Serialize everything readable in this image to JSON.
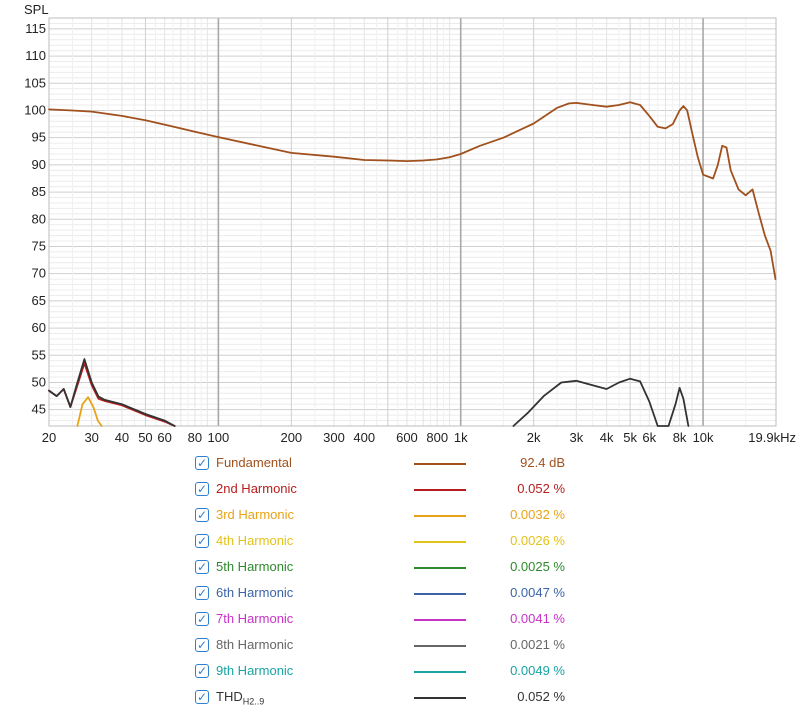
{
  "chart_data": {
    "type": "line",
    "title": "",
    "ylabel": "SPL",
    "xlabel": "",
    "xscale": "log",
    "xlim": [
      20,
      20000
    ],
    "ylim": [
      42,
      117
    ],
    "grid": true,
    "y_ticks": [
      45,
      50,
      55,
      60,
      65,
      70,
      75,
      80,
      85,
      90,
      95,
      100,
      105,
      110,
      115
    ],
    "x_tick_values": [
      20,
      30,
      40,
      50,
      60,
      80,
      100,
      200,
      300,
      400,
      600,
      800,
      1000,
      2000,
      3000,
      4000,
      5000,
      6000,
      8000,
      10000,
      19900
    ],
    "x_tick_labels": [
      "20",
      "30",
      "40",
      "50",
      "60",
      "80",
      "100",
      "200",
      "300",
      "400",
      "600",
      "800",
      "1k",
      "2k",
      "3k",
      "4k",
      "5k",
      "6k",
      "8k",
      "10k",
      "19.9kHz"
    ],
    "series": [
      {
        "name": "Fundamental",
        "color": "#a0511d",
        "x": [
          20,
          25,
          30,
          40,
          50,
          60,
          80,
          100,
          150,
          200,
          300,
          400,
          500,
          600,
          700,
          800,
          900,
          1000,
          1200,
          1500,
          2000,
          2500,
          2800,
          3000,
          3500,
          4000,
          4500,
          5000,
          5500,
          6000,
          6500,
          7000,
          7500,
          8000,
          8300,
          8600,
          9000,
          9500,
          10000,
          11000,
          11500,
          12000,
          12500,
          13000,
          14000,
          15000,
          16000,
          17000,
          18000,
          19000,
          19900
        ],
        "y": [
          100.2,
          100,
          99.8,
          99,
          98.2,
          97.4,
          96.1,
          95.1,
          93.4,
          92.2,
          91.5,
          90.9,
          90.8,
          90.7,
          90.8,
          91,
          91.4,
          92,
          93.5,
          95,
          97.6,
          100.5,
          101.3,
          101.4,
          101,
          100.7,
          101,
          101.5,
          101,
          99,
          97,
          96.7,
          97.5,
          100,
          100.8,
          100,
          96,
          91.5,
          88.2,
          87.5,
          90,
          93.5,
          93.2,
          89,
          85.5,
          84.4,
          85.5,
          81,
          77,
          74.2,
          69
        ]
      },
      {
        "name": "2nd Harmonic",
        "color": "#b81d1d",
        "x": [
          20,
          21.5,
          23,
          24.5,
          26,
          28,
          30,
          32,
          34,
          40,
          50,
          60,
          66
        ],
        "y": [
          48.5,
          47.5,
          48.8,
          45.5,
          49,
          53.5,
          49.5,
          47,
          46.6,
          45.8,
          44,
          42.8,
          42
        ]
      },
      {
        "name": "3rd Harmonic",
        "color": "#e8a317",
        "x": [
          26.2,
          27.5,
          29,
          30.5,
          31.8,
          33
        ],
        "y": [
          42,
          46,
          47.3,
          45.5,
          43,
          42
        ]
      },
      {
        "name": "THD H2..9",
        "color": "#333333",
        "x": [
          20,
          21.5,
          23,
          24.5,
          26,
          28,
          30,
          32,
          34,
          40,
          50,
          60,
          66,
          1650,
          1900,
          2200,
          2600,
          3000,
          3500,
          4000,
          4500,
          5000,
          5500,
          6000,
          6500,
          7200,
          7700,
          8000,
          8300,
          8700
        ],
        "y": [
          48.5,
          47.5,
          48.8,
          45.5,
          49.5,
          54.3,
          50,
          47.4,
          46.8,
          46,
          44.2,
          43,
          42,
          42,
          44.5,
          47.5,
          50,
          50.3,
          49.5,
          48.8,
          50,
          50.7,
          50.2,
          46.5,
          42,
          42,
          46,
          49,
          47,
          42
        ]
      }
    ]
  },
  "legend": [
    {
      "label": "Fundamental",
      "value": "92.4 dB",
      "color": "#a0511d"
    },
    {
      "label": "2nd Harmonic",
      "value": "0.052 %",
      "color": "#b81d1d"
    },
    {
      "label": "3rd Harmonic",
      "value": "0.0032 %",
      "color": "#e8a317"
    },
    {
      "label": "4th Harmonic",
      "value": "0.0026 %",
      "color": "#e3c21a"
    },
    {
      "label": "5th Harmonic",
      "value": "0.0025 %",
      "color": "#2d8a2d"
    },
    {
      "label": "6th Harmonic",
      "value": "0.0047 %",
      "color": "#3b64a8"
    },
    {
      "label": "7th Harmonic",
      "value": "0.0041 %",
      "color": "#c832c8"
    },
    {
      "label": "8th Harmonic",
      "value": "0.0021 %",
      "color": "#666666"
    },
    {
      "label": "9th Harmonic",
      "value": "0.0049 %",
      "color": "#19a3a3"
    },
    {
      "label": "THD",
      "label_sub": "H2..9",
      "value": "0.052 %",
      "color": "#333333"
    }
  ],
  "checkbox_glyph": "✓"
}
